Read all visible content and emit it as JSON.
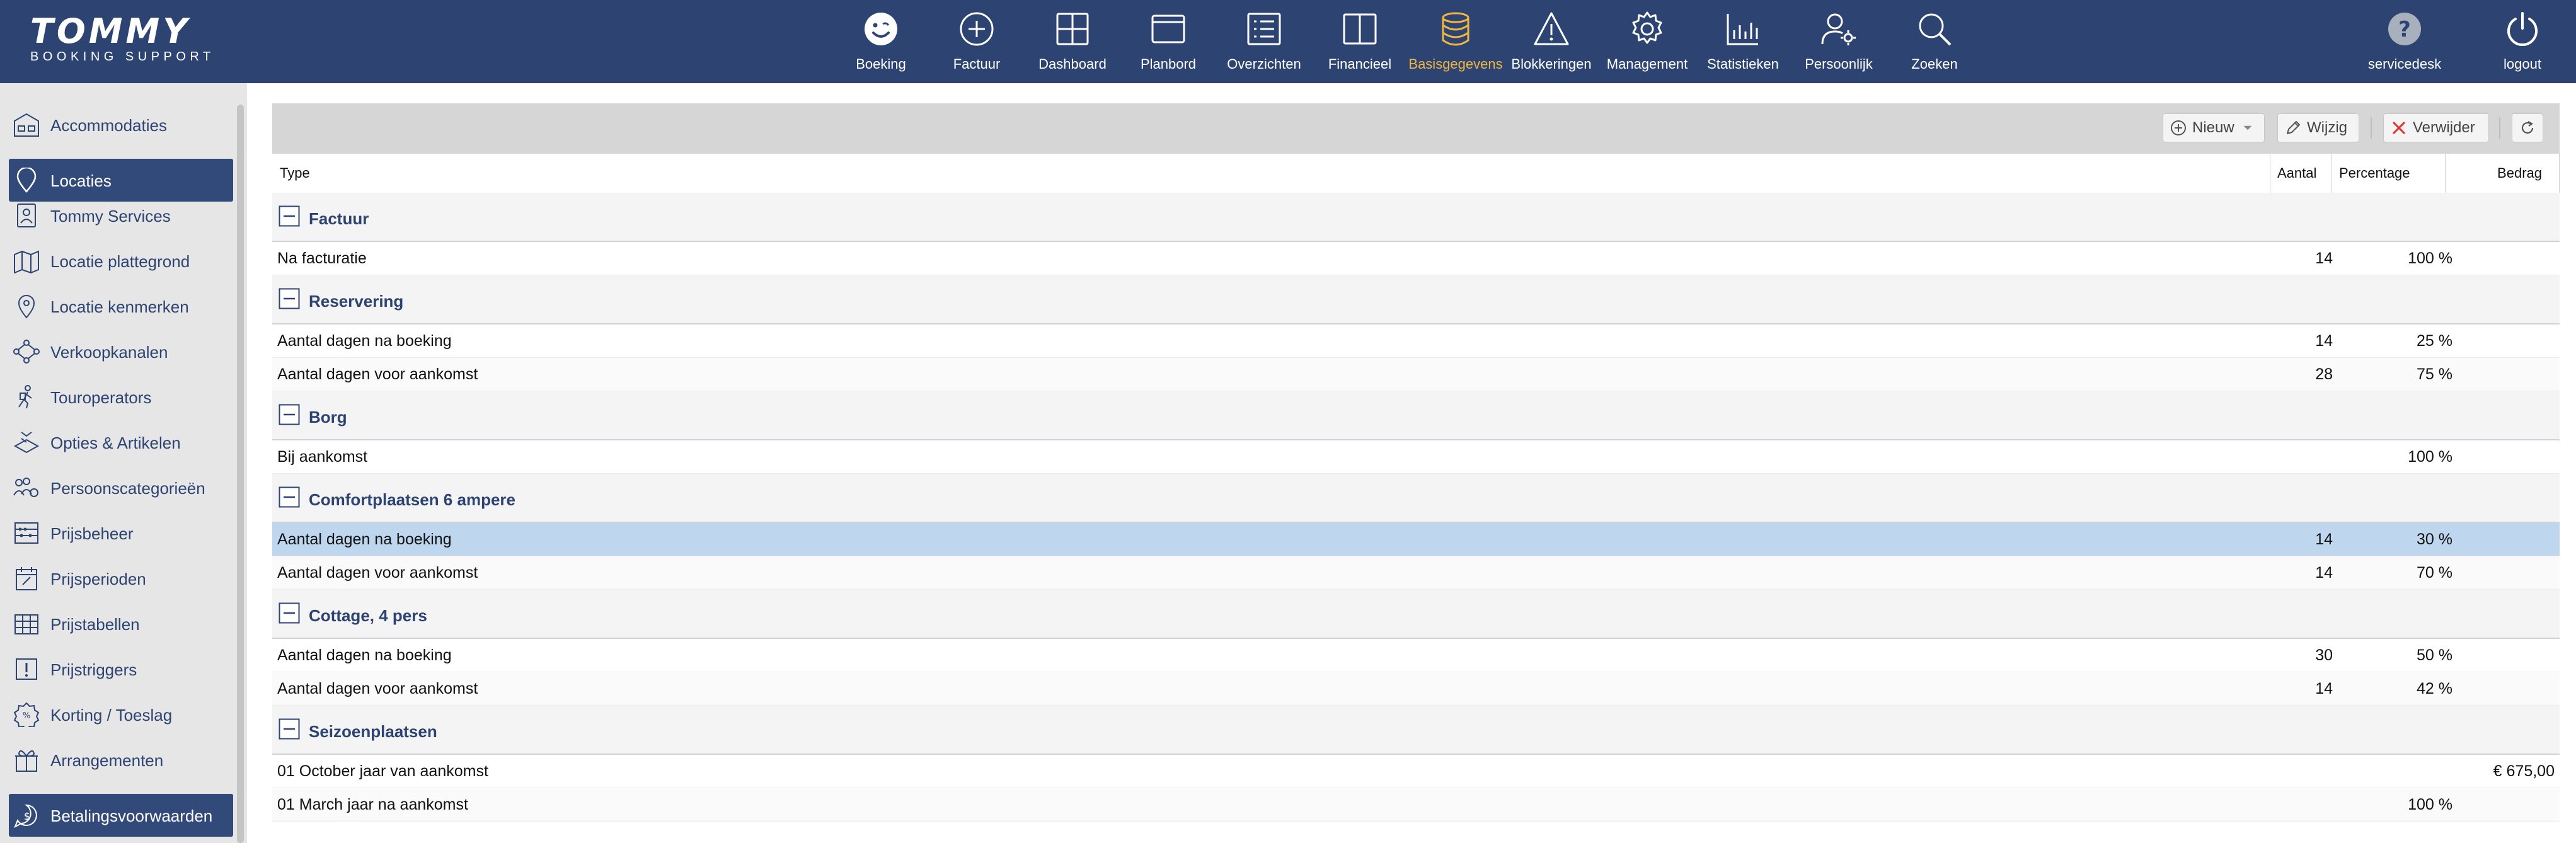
{
  "app": {
    "logo_main": "TOMMY",
    "logo_sub": "BOOKING SUPPORT"
  },
  "nav": {
    "items": [
      {
        "label": "Boeking",
        "icon": "smiley-icon"
      },
      {
        "label": "Factuur",
        "icon": "plus-circle-icon"
      },
      {
        "label": "Dashboard",
        "icon": "dashboard-grid-icon"
      },
      {
        "label": "Planbord",
        "icon": "planbord-window-icon"
      },
      {
        "label": "Overzichten",
        "icon": "list-icon"
      },
      {
        "label": "Financieel",
        "icon": "book-icon"
      },
      {
        "label": "Basisgegevens",
        "icon": "database-icon",
        "active": true
      },
      {
        "label": "Blokkeringen",
        "icon": "warning-icon"
      },
      {
        "label": "Management",
        "icon": "gear-icon"
      },
      {
        "label": "Statistieken",
        "icon": "bar-chart-icon"
      },
      {
        "label": "Persoonlijk",
        "icon": "user-settings-icon"
      },
      {
        "label": "Zoeken",
        "icon": "search-icon"
      }
    ],
    "right": [
      {
        "label": "servicedesk",
        "icon": "help-icon"
      },
      {
        "label": "logout",
        "icon": "power-icon"
      }
    ],
    "active_color": "#f0b640",
    "bar_color": "#2d4472"
  },
  "sidebar": {
    "items": [
      {
        "label": "Accommodaties",
        "icon": "accommodation-icon"
      },
      {
        "label": "Locaties",
        "icon": "location-pin-icon",
        "active": true
      },
      {
        "label": "Tommy Services",
        "icon": "id-card-icon"
      },
      {
        "label": "Locatie plattegrond",
        "icon": "map-icon"
      },
      {
        "label": "Locatie kenmerken",
        "icon": "location-tag-icon"
      },
      {
        "label": "Verkoopkanalen",
        "icon": "network-icon"
      },
      {
        "label": "Touroperators",
        "icon": "traveler-icon"
      },
      {
        "label": "Opties & Artikelen",
        "icon": "options-icon"
      },
      {
        "label": "Persoonscategorieën",
        "icon": "people-settings-icon"
      },
      {
        "label": "Prijsbeheer",
        "icon": "abacus-icon"
      },
      {
        "label": "Prijsperioden",
        "icon": "calendar-icon"
      },
      {
        "label": "Prijstabellen",
        "icon": "table-icon"
      },
      {
        "label": "Prijstriggers",
        "icon": "exclamation-box-icon"
      },
      {
        "label": "Korting / Toeslag",
        "icon": "discount-icon"
      },
      {
        "label": "Arrangementen",
        "icon": "gift-icon"
      },
      {
        "label": "Betalingsvoorwaarden",
        "icon": "payment-icon",
        "active": true
      }
    ]
  },
  "toolbar": {
    "new_label": "Nieuw",
    "edit_label": "Wijzig",
    "delete_label": "Verwijder"
  },
  "table": {
    "columns": [
      "Type",
      "Aantal",
      "Percentage",
      "Bedrag"
    ],
    "groups": [
      {
        "name": "Factuur",
        "rows": [
          {
            "type": "Na facturatie",
            "aantal": "14",
            "percentage": "100 %",
            "bedrag": ""
          }
        ]
      },
      {
        "name": "Reservering",
        "rows": [
          {
            "type": "Aantal dagen na boeking",
            "aantal": "14",
            "percentage": "25 %",
            "bedrag": ""
          },
          {
            "type": "Aantal dagen voor aankomst",
            "aantal": "28",
            "percentage": "75 %",
            "bedrag": ""
          }
        ]
      },
      {
        "name": "Borg",
        "rows": [
          {
            "type": "Bij aankomst",
            "aantal": "",
            "percentage": "100 %",
            "bedrag": ""
          }
        ]
      },
      {
        "name": "Comfortplaatsen 6 ampere",
        "rows": [
          {
            "type": "Aantal dagen na boeking",
            "aantal": "14",
            "percentage": "30 %",
            "bedrag": "",
            "selected": true
          },
          {
            "type": "Aantal dagen voor aankomst",
            "aantal": "14",
            "percentage": "70 %",
            "bedrag": ""
          }
        ]
      },
      {
        "name": "Cottage, 4 pers",
        "rows": [
          {
            "type": "Aantal dagen na boeking",
            "aantal": "30",
            "percentage": "50 %",
            "bedrag": ""
          },
          {
            "type": "Aantal dagen voor aankomst",
            "aantal": "14",
            "percentage": "42 %",
            "bedrag": ""
          }
        ]
      },
      {
        "name": "Seizoenplaatsen",
        "rows": [
          {
            "type": "01 October jaar van aankomst",
            "aantal": "",
            "percentage": "",
            "bedrag": "€ 675,00"
          },
          {
            "type": "01 March jaar na aankomst",
            "aantal": "",
            "percentage": "100 %",
            "bedrag": ""
          }
        ]
      }
    ]
  }
}
